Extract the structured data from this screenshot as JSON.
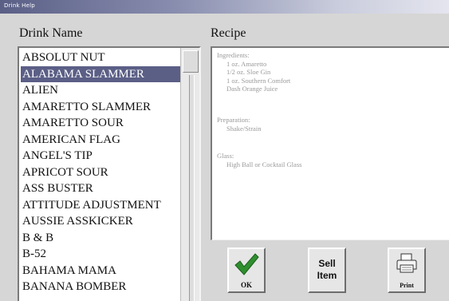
{
  "window": {
    "title": "Drink Help"
  },
  "headers": {
    "drink_name": "Drink Name",
    "recipe": "Recipe"
  },
  "drinks": [
    "ABSOLUT NUT",
    "ALABAMA SLAMMER",
    "ALIEN",
    "AMARETTO SLAMMER",
    "AMARETTO SOUR",
    "AMERICAN FLAG",
    "ANGEL'S TIP",
    "APRICOT SOUR",
    "ASS BUSTER",
    "ATTITUDE ADJUSTMENT",
    "AUSSIE ASSKICKER",
    "B & B",
    "B-52",
    "BAHAMA MAMA",
    "BANANA BOMBER"
  ],
  "selected_index": 1,
  "recipe": {
    "ingredients_label": "Ingredients:",
    "ingredients": [
      "1 oz. Amaretto",
      "1/2 oz. Sloe Gin",
      "1 oz. Southern Comfort",
      "Dash Orange Juice"
    ],
    "preparation_label": "Preparation:",
    "preparation": "Shake/Strain",
    "glass_label": "Glass:",
    "glass": "High Ball or Cocktail Glass"
  },
  "buttons": {
    "ok": "OK",
    "sell_line1": "Sell",
    "sell_line2": "Item",
    "print": "Print"
  },
  "colors": {
    "selection": "#5b5f86",
    "check": "#2f8f2f"
  }
}
